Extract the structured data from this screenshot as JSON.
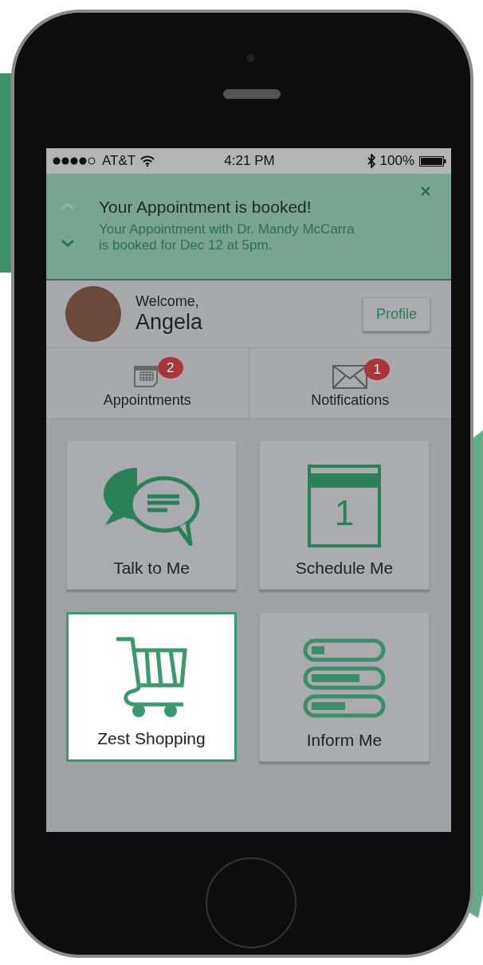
{
  "status_bar": {
    "carrier": "AT&T",
    "time": "4:21 PM",
    "battery": "100%"
  },
  "notification": {
    "title": "Your Appointment is booked!",
    "body": "Your Appointment with Dr. Mandy McCarra is booked for Dec 12 at 5pm.",
    "prev": {
      "disabled": true
    },
    "next": {
      "disabled": false
    }
  },
  "user": {
    "greeting": "Welcome,",
    "name": "Angela",
    "profile_button": "Profile"
  },
  "nav": [
    {
      "kind": "calendar",
      "label": "Appointments",
      "badge": "2"
    },
    {
      "kind": "mail",
      "label": "Notifications",
      "badge": "1"
    }
  ],
  "tile_rows": [
    {
      "tiles": [
        {
          "kind": "chat",
          "label": "Talk to Me",
          "selected": false
        },
        {
          "kind": "calendar",
          "day": "1",
          "label": "Schedule Me",
          "selected": false
        }
      ]
    },
    {
      "tiles": [
        {
          "kind": "cart",
          "label": "Zest Shopping",
          "selected": true
        },
        {
          "kind": "meters",
          "label": "Inform Me",
          "selected": false
        }
      ]
    }
  ]
}
